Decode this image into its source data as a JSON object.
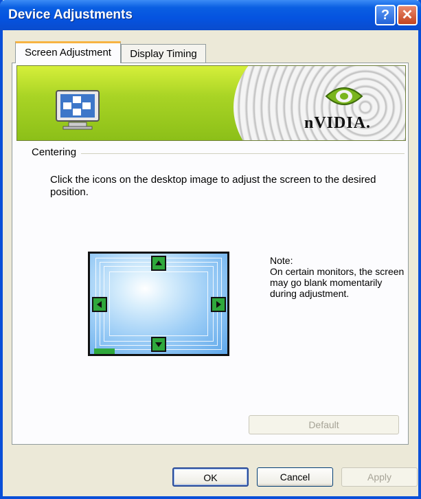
{
  "window": {
    "title": "Device Adjustments",
    "help_glyph": "?",
    "close_glyph": "✕"
  },
  "tabs": [
    {
      "label": "Screen Adjustment",
      "active": true
    },
    {
      "label": "Display Timing",
      "active": false
    }
  ],
  "banner": {
    "logo_text": "nVIDIA.",
    "brand_color": "#8bc21c"
  },
  "centering": {
    "group_label": "Centering",
    "description": "Click the icons on the desktop image to adjust the screen to the desired position.",
    "note": "Note:\nOn certain monitors, the screen may go blank momentarily during adjustment.",
    "arrows": [
      "arrow-up-icon",
      "arrow-left-icon",
      "arrow-right-icon",
      "arrow-down-icon"
    ]
  },
  "buttons": {
    "default_label": "Default",
    "ok_label": "OK",
    "cancel_label": "Cancel",
    "apply_label": "Apply"
  }
}
